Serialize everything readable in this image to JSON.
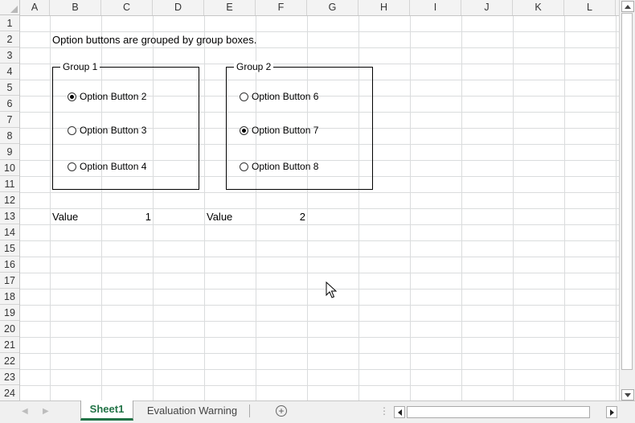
{
  "columns": [
    "A",
    "B",
    "C",
    "D",
    "E",
    "F",
    "G",
    "H",
    "I",
    "J",
    "K",
    "L"
  ],
  "rows": [
    "1",
    "2",
    "3",
    "4",
    "5",
    "6",
    "7",
    "8",
    "9",
    "10",
    "11",
    "12",
    "13",
    "14",
    "15",
    "16",
    "17",
    "18",
    "19",
    "20",
    "21",
    "22",
    "23",
    "24"
  ],
  "cells": {
    "b2": "Option buttons are grouped by group boxes.",
    "b13": "Value",
    "c13": "1",
    "e13": "Value",
    "f13": "2"
  },
  "group1": {
    "title": "Group 1",
    "options": [
      "Option Button 2",
      "Option Button 3",
      "Option Button 4"
    ],
    "selected": "Option Button 2"
  },
  "group2": {
    "title": "Group 2",
    "options": [
      "Option Button 6",
      "Option Button 7",
      "Option Button 8"
    ],
    "selected": "Option Button 7"
  },
  "tabs": {
    "active": "Sheet1",
    "other": "Evaluation Warning",
    "add_symbol": "+"
  },
  "colors": {
    "accent": "#217346",
    "gridline": "#dadcdd",
    "header_bg": "#f3f3f3"
  }
}
